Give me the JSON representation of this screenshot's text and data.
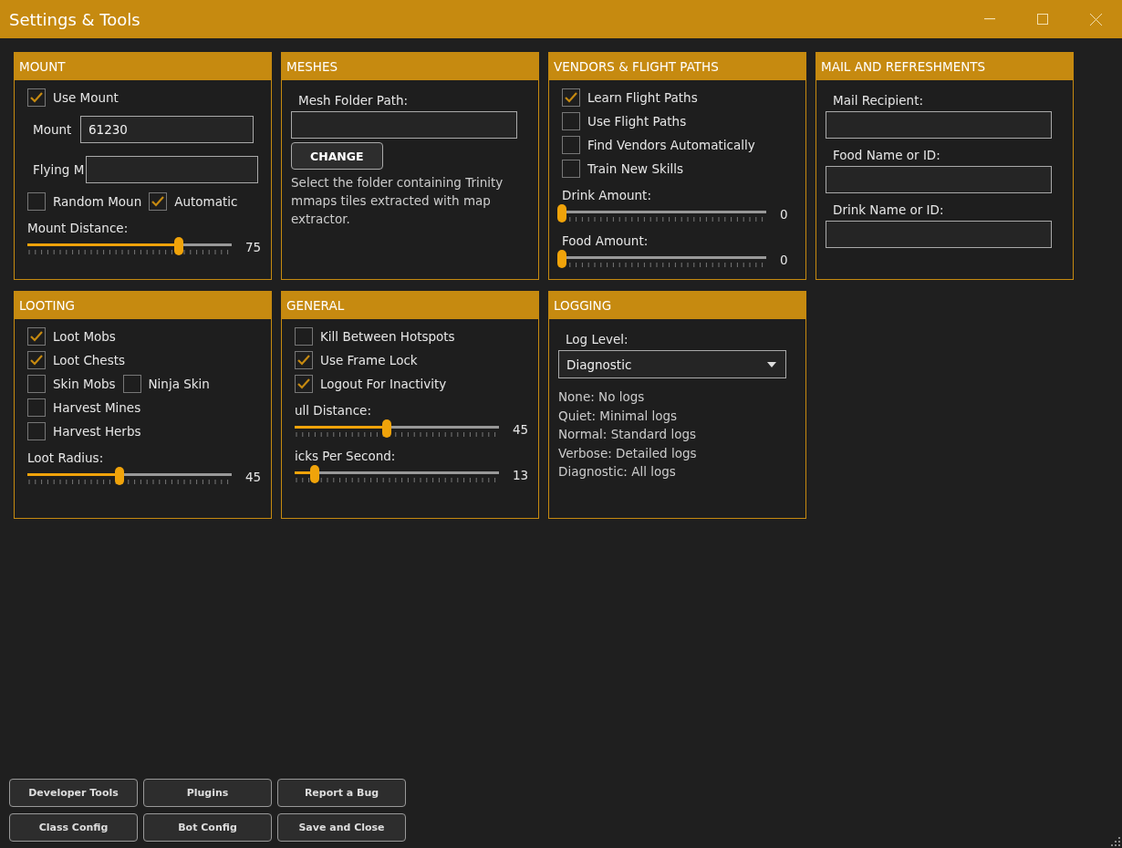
{
  "window": {
    "title": "Settings & Tools"
  },
  "panels": [
    {
      "title": "MOUNT",
      "items": [
        {
          "kind": "checkbox",
          "label": "Use Mount",
          "checked": true
        },
        {
          "kind": "inline-field",
          "label": "Mount",
          "value": "61230"
        },
        {
          "kind": "inline-field",
          "label": "Flying M"
        },
        {
          "kind": "checkbox-row",
          "checkboxes": [
            {
              "label": "Random Moun",
              "checked": false
            },
            {
              "label": "Automatic",
              "checked": true
            }
          ]
        },
        {
          "kind": "slider",
          "label": "Mount Distance:",
          "reading": "75",
          "level": 0.74
        }
      ]
    },
    {
      "title": "MESHES",
      "items": [
        {
          "kind": "field",
          "label": "Mesh Folder Path:"
        },
        {
          "kind": "button",
          "label": "CHANGE"
        },
        {
          "kind": "note",
          "text": "Select the folder containing Trinity mmaps tiles extracted with map extractor."
        }
      ]
    },
    {
      "title": "VENDORS & FLIGHT PATHS",
      "items": [
        {
          "kind": "checkbox",
          "label": "Learn Flight Paths",
          "checked": true
        },
        {
          "kind": "checkbox",
          "label": "Use Flight Paths",
          "checked": false
        },
        {
          "kind": "checkbox",
          "label": "Find Vendors Automatically",
          "checked": false
        },
        {
          "kind": "checkbox",
          "label": "Train New Skills",
          "checked": false
        },
        {
          "kind": "slider",
          "label": "Drink Amount:",
          "reading": "0",
          "level": 0
        },
        {
          "kind": "slider",
          "label": "Food Amount:",
          "reading": "0",
          "level": 0
        }
      ]
    },
    {
      "title": "MAIL AND REFRESHMENTS",
      "items": [
        {
          "kind": "field",
          "label": "Mail Recipient:"
        },
        {
          "kind": "field",
          "label": "Food Name or ID:"
        },
        {
          "kind": "field",
          "label": "Drink Name or ID:"
        }
      ]
    },
    {
      "title": "LOOTING",
      "items": [
        {
          "kind": "checkbox",
          "label": "Loot Mobs",
          "checked": true
        },
        {
          "kind": "checkbox",
          "label": "Loot Chests",
          "checked": true
        },
        {
          "kind": "checkbox-row",
          "checkboxes": [
            {
              "label": "Skin Mobs",
              "checked": false
            },
            {
              "label": "Ninja Skin",
              "checked": false
            }
          ]
        },
        {
          "kind": "checkbox",
          "label": "Harvest Mines",
          "checked": false
        },
        {
          "kind": "checkbox",
          "label": "Harvest Herbs",
          "checked": false
        },
        {
          "kind": "slider",
          "label": "Loot Radius:",
          "reading": "45",
          "level": 0.45
        }
      ]
    },
    {
      "title": "GENERAL",
      "items": [
        {
          "kind": "checkbox",
          "label": "Kill Between Hotspots",
          "checked": false
        },
        {
          "kind": "checkbox",
          "label": "Use Frame Lock",
          "checked": true
        },
        {
          "kind": "checkbox",
          "label": "Logout For Inactivity",
          "checked": true
        },
        {
          "kind": "slider",
          "label": "ull Distance:",
          "reading": "45",
          "level": 0.45
        },
        {
          "kind": "slider",
          "label": "icks Per Second:",
          "reading": "13",
          "level": 0.1
        }
      ]
    },
    {
      "title": "LOGGING",
      "items": [
        {
          "kind": "dropdown",
          "label": "Log Level:",
          "value": "Diagnostic"
        },
        {
          "kind": "lines",
          "lines": [
            "None: No logs",
            "Quiet: Minimal logs",
            "Normal: Standard logs",
            "Verbose: Detailed logs",
            "Diagnostic: All logs"
          ]
        }
      ]
    }
  ],
  "buttons": [
    [
      "Developer Tools",
      "Plugins",
      "Report a Bug"
    ],
    [
      "Class Config",
      "Bot Config",
      "Save and Close"
    ]
  ]
}
